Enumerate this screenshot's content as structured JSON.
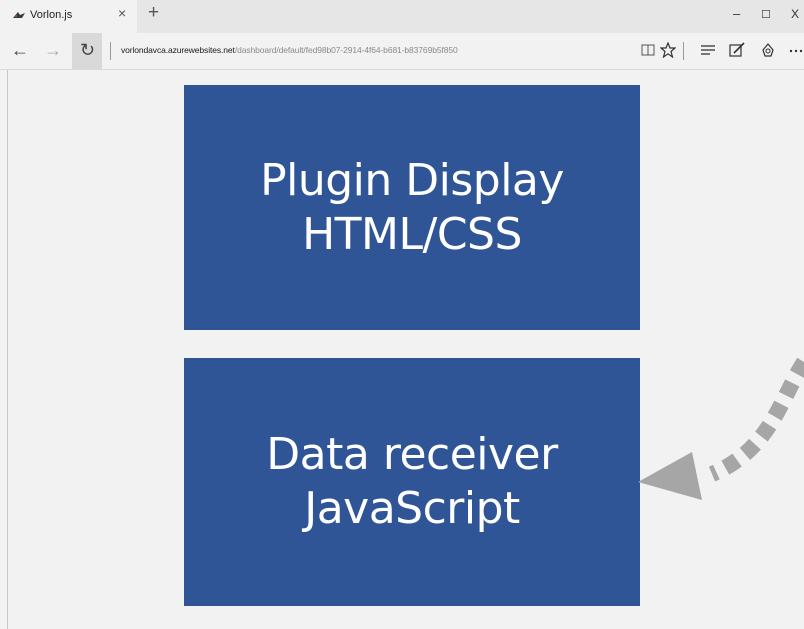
{
  "tab": {
    "title": "Vorlon.js",
    "close_glyph": "×",
    "new_tab_glyph": "+"
  },
  "window_controls": {
    "minimize": "–",
    "maximize": "☐",
    "close": "X"
  },
  "nav": {
    "back_glyph": "←",
    "forward_glyph": "→",
    "refresh_glyph": "↻",
    "url_host": "vorlondavca.azurewebsites.net",
    "url_path": "/dashboard/default/fed98b07-2914-4f64-b681-b83769b5f850"
  },
  "toolbar_icons": [
    "reading-view-icon",
    "favorite-star-icon",
    "hub-icon",
    "web-note-icon",
    "share-icon",
    "more-icon"
  ],
  "blocks": {
    "top": {
      "line1": "Plugin Display",
      "line2": "HTML/CSS"
    },
    "bottom": {
      "line1": "Data receiver",
      "line2": "JavaScript"
    }
  },
  "colors": {
    "block": "#2f5597",
    "arrow": "#a6a6a6",
    "page_bg": "#f2f2f2"
  }
}
